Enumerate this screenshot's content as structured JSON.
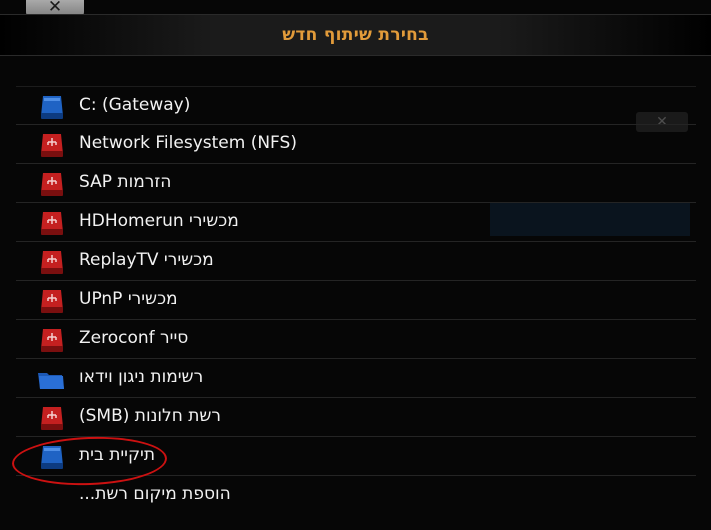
{
  "dialog": {
    "title": "בחירת שיתוף חדש",
    "close_label": "✕"
  },
  "items": [
    {
      "label": "C: (Gateway)",
      "icon": "blue-drive-icon"
    },
    {
      "label": "Network Filesystem (NFS)",
      "icon": "network-drive-icon"
    },
    {
      "label": "SAP הזרמות",
      "icon": "network-drive-icon"
    },
    {
      "label": "HDHomerun מכשירי",
      "icon": "network-drive-icon"
    },
    {
      "label": "ReplayTV מכשירי",
      "icon": "network-drive-icon"
    },
    {
      "label": "UPnP מכשירי",
      "icon": "network-drive-icon"
    },
    {
      "label": "Zeroconf סייר",
      "icon": "network-drive-icon"
    },
    {
      "label": "רשימות ניגון וידאו",
      "icon": "blue-folder-icon"
    },
    {
      "label": "(SMB) רשת חלונות",
      "icon": "network-drive-icon"
    },
    {
      "label": "תיקיית בית",
      "icon": "blue-drive-icon"
    },
    {
      "label": "הוספת מיקום רשת...",
      "icon": ""
    }
  ],
  "colors": {
    "title": "#e29b3a",
    "text": "#f2f2f2",
    "background": "#060606",
    "annotation": "#cc1111"
  }
}
